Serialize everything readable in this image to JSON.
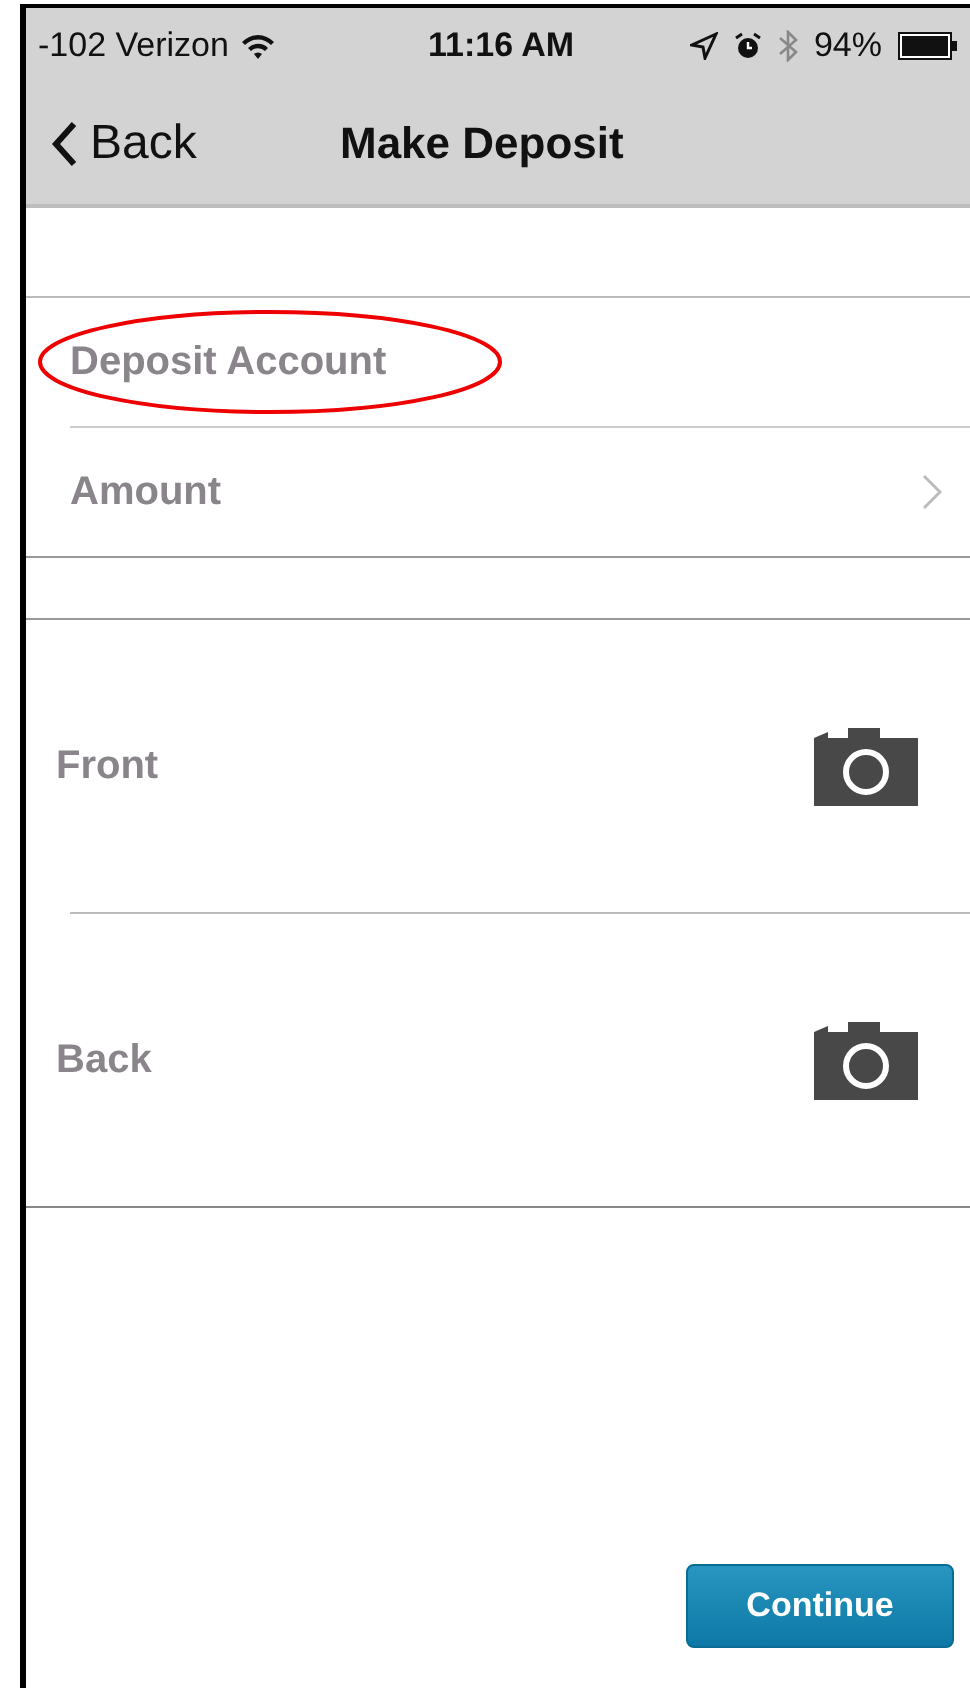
{
  "status_bar": {
    "carrier": "-102 Verizon",
    "time": "11:16 AM",
    "battery": "94%"
  },
  "nav": {
    "back": "Back",
    "title": "Make Deposit"
  },
  "fields": [
    {
      "label": "Deposit Account",
      "chevron": false,
      "annotated": true
    },
    {
      "label": "Amount",
      "chevron": true,
      "annotated": false
    }
  ],
  "photos": [
    {
      "label": "Front"
    },
    {
      "label": "Back"
    }
  ],
  "button": "Continue"
}
